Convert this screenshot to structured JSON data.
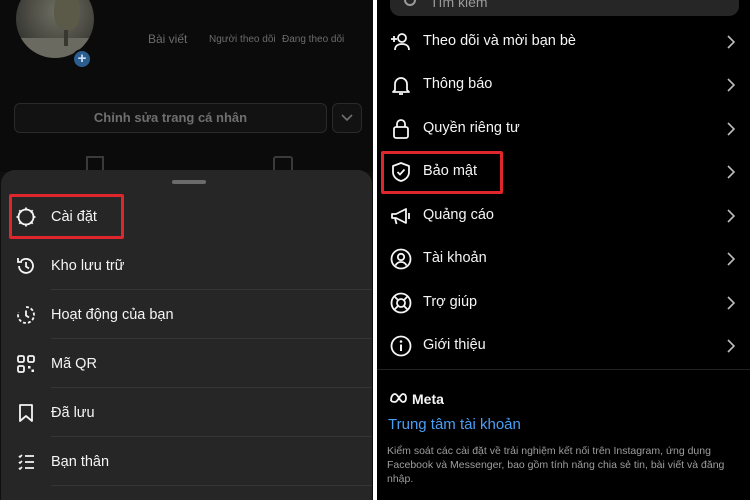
{
  "left": {
    "profile": {
      "stats": [
        "Bài viết",
        "Người theo dõi",
        "Đang theo dõi"
      ],
      "edit_button": "Chỉnh sửa trang cá nhân",
      "add_badge": "+"
    },
    "menu": [
      {
        "label": "Cài đặt",
        "icon": "settings-gear-icon"
      },
      {
        "label": "Kho lưu trữ",
        "icon": "archive-history-icon"
      },
      {
        "label": "Hoạt động của bạn",
        "icon": "activity-icon"
      },
      {
        "label": "Mã QR",
        "icon": "qr-code-icon"
      },
      {
        "label": "Đã lưu",
        "icon": "bookmark-icon"
      },
      {
        "label": "Bạn thân",
        "icon": "close-friends-list-icon"
      }
    ]
  },
  "right": {
    "search": {
      "placeholder": "Tìm kiếm"
    },
    "rows": [
      {
        "label": "Theo dõi và mời bạn bè",
        "icon": "add-person-icon"
      },
      {
        "label": "Thông báo",
        "icon": "bell-icon"
      },
      {
        "label": "Quyền riêng tư",
        "icon": "lock-icon"
      },
      {
        "label": "Bảo mật",
        "icon": "shield-check-icon"
      },
      {
        "label": "Quảng cáo",
        "icon": "megaphone-icon"
      },
      {
        "label": "Tài khoản",
        "icon": "account-circle-icon"
      },
      {
        "label": "Trợ giúp",
        "icon": "lifebuoy-icon"
      },
      {
        "label": "Giới thiệu",
        "icon": "info-icon"
      }
    ],
    "meta": {
      "brand": "Meta",
      "link": "Trung tâm tài khoản",
      "description": "Kiểm soát các cài đặt về trải nghiệm kết nối trên Instagram, ứng dụng Facebook và Messenger, bao gồm tính năng chia sẻ tin, bài viết và đăng nhập."
    }
  },
  "colors": {
    "highlight": "#e0262d",
    "link": "#4a9ff5",
    "sheet": "#262626"
  }
}
